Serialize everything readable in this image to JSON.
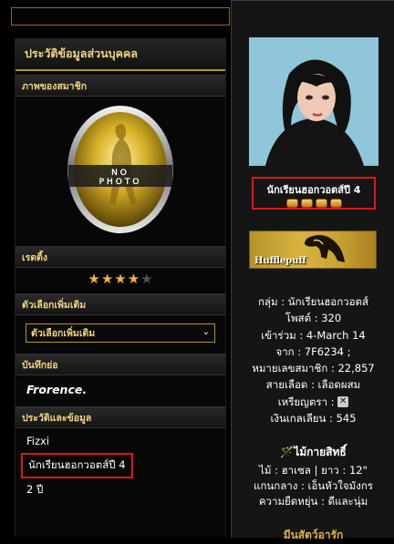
{
  "profile_panel": {
    "title": "ประวัติข้อมูลส่วนบุคคล",
    "sections": {
      "member_image": "ภาพของสมาชิก",
      "rating": "เรตติ้ง",
      "extra_options": "ตัวเลือกเพิ่มเติม",
      "notes": "บันทึกย่อ",
      "history": "ประวัติและข้อมูล"
    },
    "no_photo_text": [
      "NO",
      "PHOTO"
    ],
    "rating_stars": {
      "filled": 4,
      "total": 5
    },
    "extra_options_select": "ตัวเลือกเพิ่มเติม",
    "note_text": "Frorence.",
    "history_lines": [
      "Fizxi",
      "นักเรียนฮอกวอตส์ปี 4",
      "2 ปี"
    ]
  },
  "popup": {
    "rank": "นักเรียนฮอกวอตส์ปี 4",
    "rank_pips": 4,
    "house_banner": "Hufflepuff",
    "stats": [
      "กลุ่ม : นักเรียนฮอกวอตส์",
      "โพสต์ : 320",
      "เข้าร่วม : 4-March 14",
      "จาก : 7F6234 ;",
      "หมายเลขสมาชิก : 22,857",
      "สายเลือด : เลือดผสม",
      "เหรียญตรา :",
      "เงินเกลเลียน : 545"
    ],
    "wand_title": "ไม้กายสิทธิ์",
    "wand": [
      "ไม้ : ฮาเซล | ยาว : 12\"",
      "แกนกลาง : เอ็นหัวใจมังกร",
      "ความยืดหยุ่น : ดีและนุ่ม"
    ],
    "bottom_cut": "มีนสัตว์อารัก"
  },
  "colors": {
    "accent": "#f0d483",
    "highlight": "#e0141c",
    "house": "#d8b341"
  }
}
